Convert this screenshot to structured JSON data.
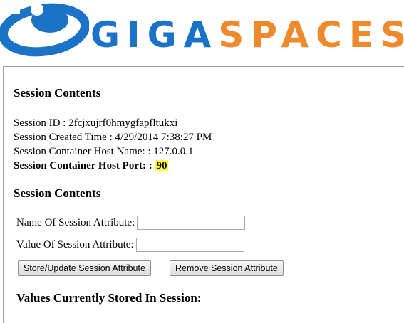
{
  "logo": {
    "part1": "GIGA",
    "part2": "SPACES",
    "colors": {
      "giga": "#1a73c6",
      "spaces": "#ef8a2c"
    }
  },
  "session": {
    "heading": "Session Contents",
    "id_text": "Session ID : 2fcjxujrf0hmygfapfltukxi",
    "created_text": "Session Created Time : 4/29/2014 7:38:27 PM",
    "host_name_text": "Session Container Host Name: : 127.0.0.1",
    "host_port_label": "Session Container Host Port: : ",
    "host_port_value": "90"
  },
  "form": {
    "heading": "Session Contents",
    "name_label": "Name Of Session Attribute:",
    "name_value": "",
    "value_label": "Value Of Session Attribute:",
    "value_value": "",
    "store_button": "Store/Update Session Attribute",
    "remove_button": "Remove Session Attribute"
  },
  "values_heading": "Values Currently Stored In Session:"
}
